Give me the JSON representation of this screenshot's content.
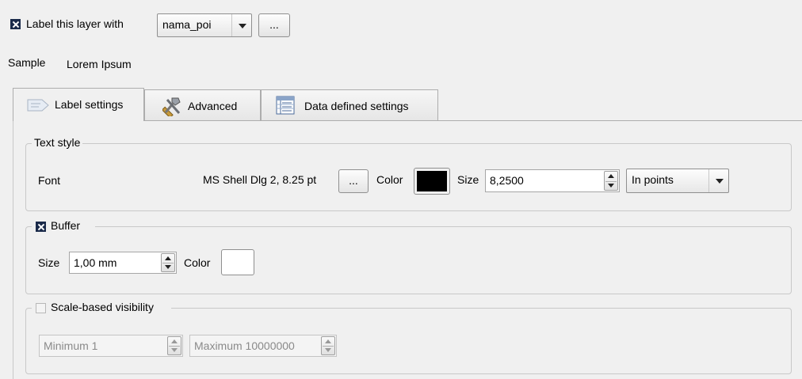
{
  "top": {
    "label_checkbox_text": "Label this layer with",
    "field_value": "nama_poi",
    "ellipsis_label": "...",
    "sample_label": "Sample",
    "sample_text": "Lorem Ipsum"
  },
  "tabs": [
    {
      "label": "Label settings",
      "icon": "label-icon"
    },
    {
      "label": "Advanced",
      "icon": "tools-icon"
    },
    {
      "label": "Data defined settings",
      "icon": "table-icon"
    }
  ],
  "text_style": {
    "title": "Text style",
    "font_label": "Font",
    "font_value": "MS Shell Dlg 2, 8.25 pt",
    "ellipsis_label": "...",
    "color_label": "Color",
    "color_value": "#000000",
    "size_label": "Size",
    "size_value": "8,2500",
    "unit_value": "In points"
  },
  "buffer": {
    "title": "Buffer",
    "checked": true,
    "size_label": "Size",
    "size_value": "1,00 mm",
    "color_label": "Color",
    "color_value": "#ffffff"
  },
  "scale": {
    "title": "Scale-based visibility",
    "checked": false,
    "min_value": "Minimum 1",
    "max_value": "Maximum 10000000"
  }
}
